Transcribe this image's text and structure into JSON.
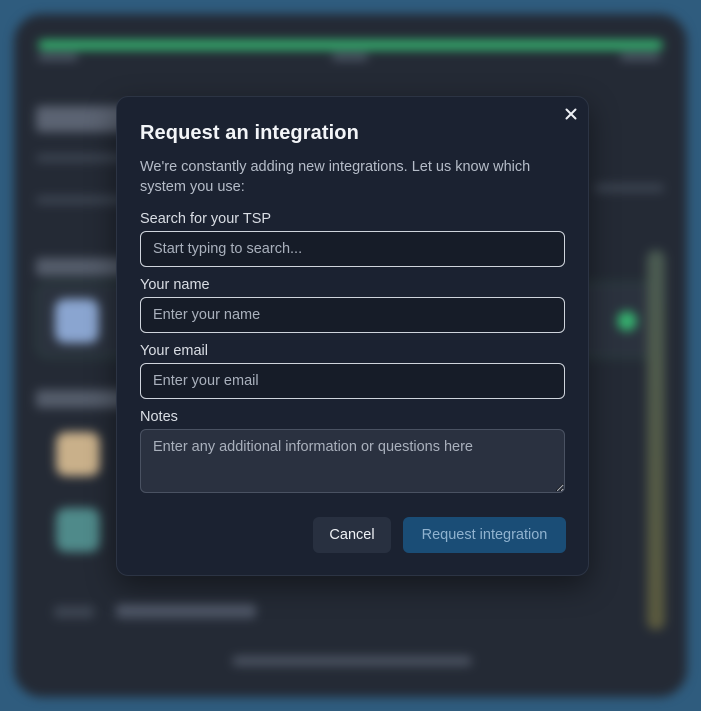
{
  "modal": {
    "title": "Request an integration",
    "description": "We're constantly adding new integrations. Let us know which system you use:",
    "close_icon": "close-icon",
    "fields": {
      "tsp": {
        "label": "Search for your TSP",
        "placeholder": "Start typing to search...",
        "value": ""
      },
      "name": {
        "label": "Your name",
        "placeholder": "Enter your name",
        "value": ""
      },
      "email": {
        "label": "Your email",
        "placeholder": "Enter your email",
        "value": ""
      },
      "notes": {
        "label": "Notes",
        "placeholder": "Enter any additional information or questions here",
        "value": ""
      }
    },
    "buttons": {
      "cancel": "Cancel",
      "request": "Request integration"
    }
  },
  "colors": {
    "modal_bg": "#1b2231",
    "primary_button": "#1a4d76",
    "primary_button_text": "#8fb2cf",
    "progress_green": "#35b06e",
    "backdrop": "#2f5c7e"
  }
}
